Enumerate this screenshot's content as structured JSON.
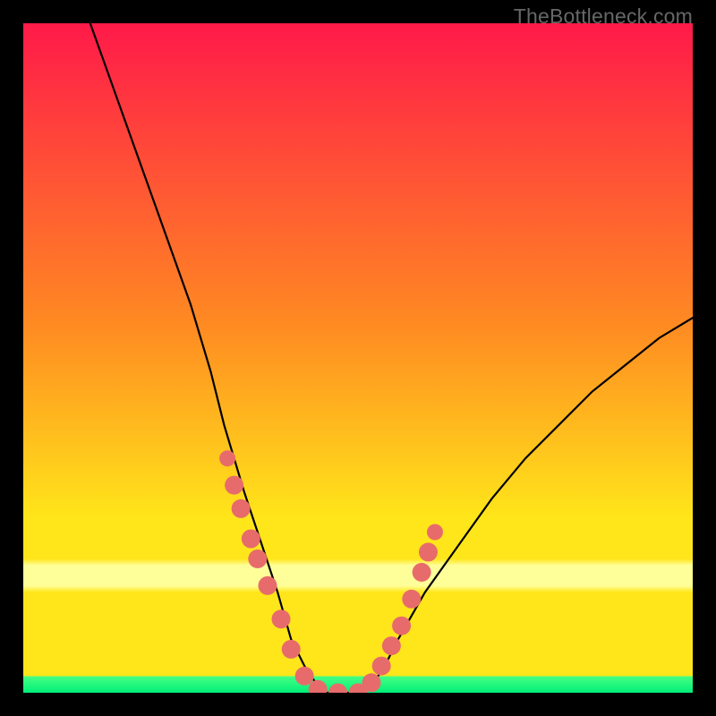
{
  "watermark": "TheBottleneck.com",
  "colors": {
    "red_top": "#ff1a49",
    "orange": "#ff8a22",
    "yellow": "#ffe61a",
    "pale_yellow": "#ffff9a",
    "green_band_top": "#48ff82",
    "green_band_bottom": "#00ef7a",
    "curve": "#000000",
    "marker": "#e86b6b",
    "background": "#000000"
  },
  "chart_data": {
    "type": "line",
    "title": "",
    "xlabel": "",
    "ylabel": "",
    "xlim": [
      0,
      100
    ],
    "ylim": [
      0,
      100
    ],
    "grid": false,
    "legend": false,
    "annotations": [
      "TheBottleneck.com"
    ],
    "series": [
      {
        "name": "bottleneck-curve",
        "x": [
          10,
          15,
          20,
          25,
          28,
          30,
          33,
          35,
          38,
          40,
          42,
          44,
          45,
          50,
          52,
          54,
          56,
          60,
          65,
          70,
          75,
          80,
          85,
          90,
          95,
          100
        ],
        "y": [
          100,
          86,
          72,
          58,
          48,
          40,
          30,
          24,
          15,
          8,
          4,
          1,
          0,
          0,
          1,
          4,
          8,
          15,
          22,
          29,
          35,
          40,
          45,
          49,
          53,
          56
        ]
      }
    ],
    "markers": [
      {
        "x": 30.5,
        "y": 35,
        "r": 1.2
      },
      {
        "x": 31.5,
        "y": 31,
        "r": 1.4
      },
      {
        "x": 32.5,
        "y": 27.5,
        "r": 1.4
      },
      {
        "x": 34,
        "y": 23,
        "r": 1.4
      },
      {
        "x": 35,
        "y": 20,
        "r": 1.4
      },
      {
        "x": 36.5,
        "y": 16,
        "r": 1.4
      },
      {
        "x": 38.5,
        "y": 11,
        "r": 1.4
      },
      {
        "x": 40,
        "y": 6.5,
        "r": 1.4
      },
      {
        "x": 42,
        "y": 2.5,
        "r": 1.4
      },
      {
        "x": 44,
        "y": 0.5,
        "r": 1.4
      },
      {
        "x": 47,
        "y": 0,
        "r": 1.4
      },
      {
        "x": 50,
        "y": 0,
        "r": 1.4
      },
      {
        "x": 52,
        "y": 1.5,
        "r": 1.4
      },
      {
        "x": 53.5,
        "y": 4,
        "r": 1.4
      },
      {
        "x": 55,
        "y": 7,
        "r": 1.4
      },
      {
        "x": 56.5,
        "y": 10,
        "r": 1.4
      },
      {
        "x": 58,
        "y": 14,
        "r": 1.4
      },
      {
        "x": 59.5,
        "y": 18,
        "r": 1.4
      },
      {
        "x": 60.5,
        "y": 21,
        "r": 1.4
      },
      {
        "x": 61.5,
        "y": 24,
        "r": 1.2
      }
    ],
    "bands": [
      {
        "name": "pale-yellow",
        "y_from": 15.5,
        "y_to": 20
      },
      {
        "name": "green",
        "y_from": 0,
        "y_to": 2.5
      }
    ]
  }
}
